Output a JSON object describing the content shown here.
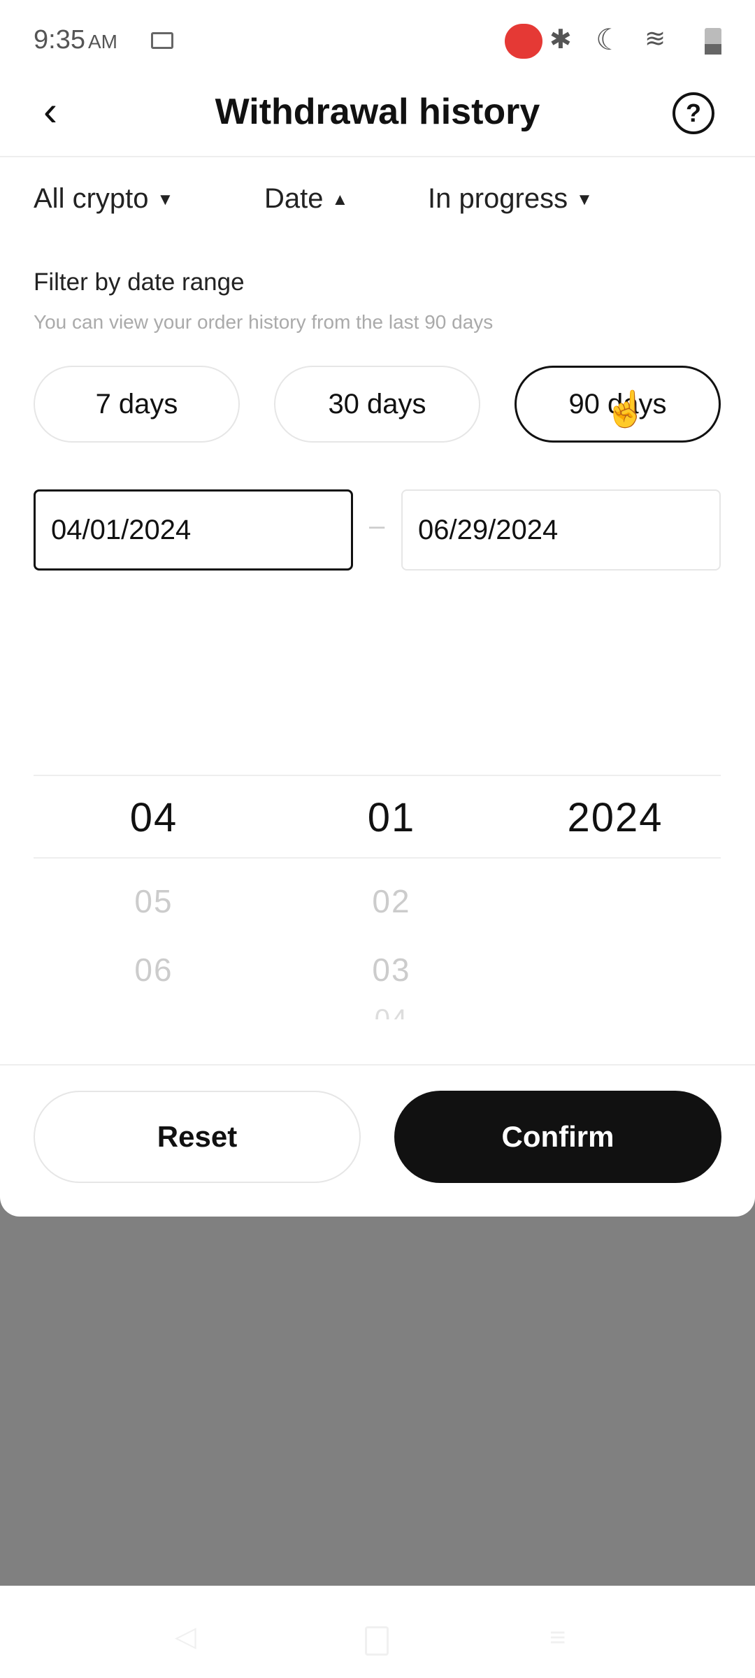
{
  "status_bar": {
    "time": "9:35",
    "ampm": "AM"
  },
  "header": {
    "title": "Withdrawal history"
  },
  "filters": [
    {
      "label": "All crypto",
      "arrow": "▼"
    },
    {
      "label": "Date",
      "arrow": "▲"
    },
    {
      "label": "In progress",
      "arrow": "▼"
    }
  ],
  "date_filter": {
    "heading": "Filter by date range",
    "subtitle": "You can view your order history from the last 90 days",
    "presets": [
      {
        "label": "7 days",
        "selected": false
      },
      {
        "label": "30 days",
        "selected": false
      },
      {
        "label": "90 days",
        "selected": true
      }
    ],
    "start_date": "04/01/2024",
    "end_date": "06/29/2024",
    "separator": "–"
  },
  "picker": {
    "month": {
      "selected": "04",
      "next": [
        "05",
        "06"
      ]
    },
    "day": {
      "selected": "01",
      "next": [
        "02",
        "03",
        "04"
      ]
    },
    "year": {
      "selected": "2024"
    }
  },
  "actions": {
    "reset": "Reset",
    "confirm": "Confirm"
  },
  "colors": {
    "accent": "#111111",
    "overlay": "#808080",
    "record_badge": "#e53935"
  }
}
